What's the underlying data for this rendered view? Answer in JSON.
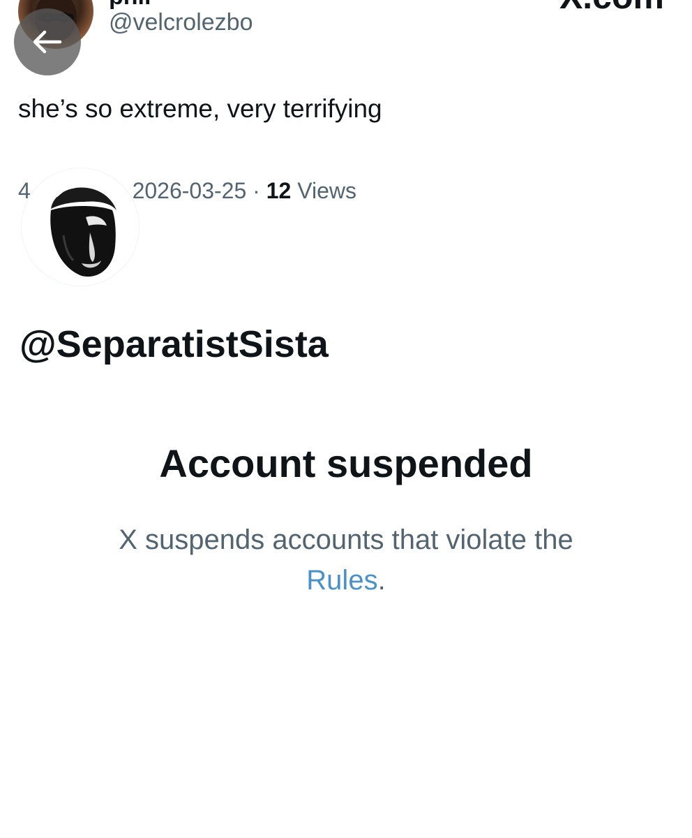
{
  "header": {
    "brand": "X.com",
    "poster_name_partial": "phil",
    "poster_handle": "@velcrolezbo"
  },
  "tweet": {
    "text": "she’s so extreme, very terrifying",
    "meta_prefix": "4",
    "date": "2026-03-25",
    "separator": "·",
    "views_count": "12",
    "views_label": "Views"
  },
  "suspended_profile": {
    "handle": "@SeparatistSista",
    "title": "Account suspended",
    "description": "X suspends accounts that violate the",
    "rules_link": "Rules",
    "period": "."
  },
  "icons": {
    "back": "arrow-left-icon"
  }
}
